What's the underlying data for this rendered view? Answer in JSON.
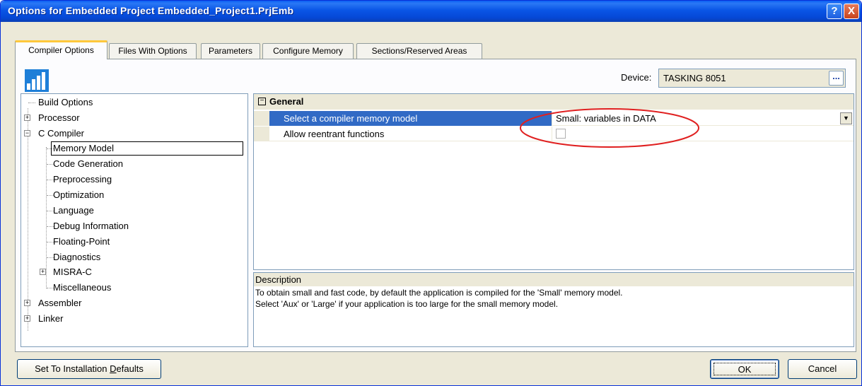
{
  "window": {
    "title": "Options for Embedded Project Embedded_Project1.PrjEmb",
    "help_glyph": "?",
    "close_glyph": "X"
  },
  "tabs": [
    {
      "label": "Compiler Options",
      "active": true
    },
    {
      "label": "Files With Options",
      "active": false
    },
    {
      "label": "Parameters",
      "active": false
    },
    {
      "label": "Configure Memory",
      "active": false
    },
    {
      "label": "Sections/Reserved Areas",
      "active": false
    }
  ],
  "app_icon": "bar-chart-icon",
  "device": {
    "label": "Device:",
    "value": "TASKING 8051",
    "browse_label": "..."
  },
  "tree": {
    "items": [
      {
        "label": "Build Options",
        "expander": ""
      },
      {
        "label": "Processor",
        "expander": "+"
      },
      {
        "label": "C Compiler",
        "expander": "−"
      },
      {
        "label": "Memory Model",
        "expander": "",
        "selected": true
      },
      {
        "label": "Code Generation",
        "expander": ""
      },
      {
        "label": "Preprocessing",
        "expander": ""
      },
      {
        "label": "Optimization",
        "expander": ""
      },
      {
        "label": "Language",
        "expander": ""
      },
      {
        "label": "Debug Information",
        "expander": ""
      },
      {
        "label": "Floating-Point",
        "expander": ""
      },
      {
        "label": "Diagnostics",
        "expander": ""
      },
      {
        "label": "MISRA-C",
        "expander": "+"
      },
      {
        "label": "Miscellaneous",
        "expander": ""
      },
      {
        "label": "Assembler",
        "expander": "+"
      },
      {
        "label": "Linker",
        "expander": "+"
      }
    ]
  },
  "grid": {
    "section_sign": "−",
    "section_label": "General",
    "rows": [
      {
        "name": "Select a compiler memory model",
        "value": "Small: variables in DATA"
      },
      {
        "name": "Allow reentrant functions",
        "value": "",
        "checked": false
      }
    ],
    "highlight_color": "#e02020"
  },
  "description": {
    "title": "Description",
    "lines": [
      "To obtain small and fast code, by default the application is compiled for the 'Small' memory model.",
      "Select 'Aux' or 'Large' if your application is too large for the small memory model."
    ]
  },
  "buttons": {
    "defaults_prefix": "Set To Installation ",
    "defaults_mnemonic": "D",
    "defaults_suffix": "efaults",
    "ok": "OK",
    "cancel": "Cancel"
  },
  "colors": {
    "selection": "#316ac5",
    "title_blue": "#0a55e6",
    "tab_accent": "#ffc83c"
  }
}
